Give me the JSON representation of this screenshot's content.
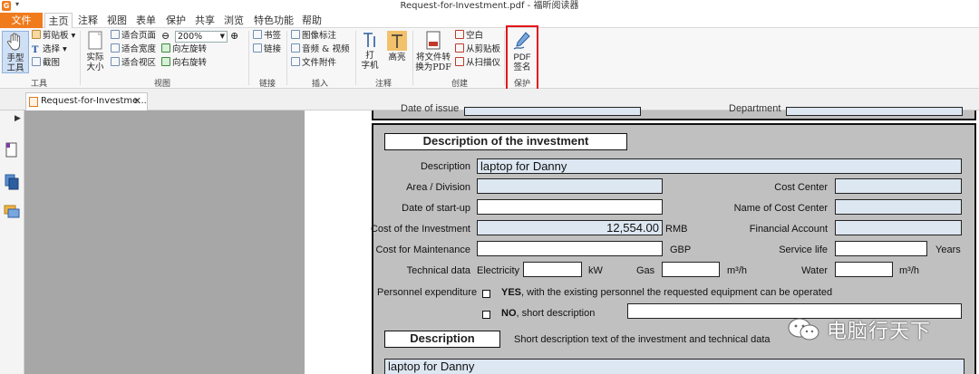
{
  "window": {
    "title": "Request-for-Investment.pdf - 福昕阅读器"
  },
  "menu": {
    "tabs": [
      "文件",
      "主页",
      "注释",
      "视图",
      "表单",
      "保护",
      "共享",
      "浏览",
      "特色功能",
      "帮助"
    ]
  },
  "ribbon": {
    "tools": {
      "hand_label_1": "手型",
      "hand_label_2": "工具",
      "clipboard": "剪贴板",
      "select": "选择",
      "screenshot": "截图",
      "group_label": "工具"
    },
    "view": {
      "actual_size_1": "实际",
      "actual_size_2": "大小",
      "fit_page": "适合页面",
      "fit_width": "适合宽度",
      "fit_visible": "适合视区",
      "zoom_value": "200%",
      "rotate_left": "向左旋转",
      "rotate_right": "向右旋转",
      "group_label": "视图"
    },
    "links": {
      "bookmark": "书签",
      "link": "链接",
      "group_label": "链接"
    },
    "insert": {
      "image_annot": "图像标注",
      "audio_video": "音频 & 视频",
      "file_attachment": "文件附件",
      "group_label": "插入"
    },
    "annot": {
      "typewriter_1": "打",
      "typewriter_2": "字机",
      "highlight": "高亮",
      "group_label": "注释"
    },
    "create": {
      "convert_1": "将文件转",
      "convert_2": "换为PDF",
      "blank": "空白",
      "from_clipboard": "从剪贴板",
      "from_scanner": "从扫描仪",
      "group_label": "创建"
    },
    "protect": {
      "pdf_sign_1": "PDF",
      "pdf_sign_2": "签名",
      "group_label": "保护"
    }
  },
  "doc_tab": {
    "label": "Request-for-Investme...",
    "close": "✕"
  },
  "form": {
    "top_cut_labels": {
      "date_of_issue": "Date of issue",
      "department": "Department"
    },
    "section1_title": "Description of the investment",
    "description_label": "Description",
    "description_value": "laptop for Danny",
    "area_label": "Area / Division",
    "cost_center_label": "Cost Center",
    "start_label": "Date of start-up",
    "cost_center_name_label": "Name of Cost Center",
    "cost_inv_label": "Cost of the Investment",
    "cost_inv_value": "12,554.00",
    "cost_inv_unit": "RMB",
    "fin_account_label": "Financial Account",
    "cost_maint_label": "Cost for Maintenance",
    "cost_maint_unit": "GBP",
    "service_life_label": "Service life",
    "service_life_unit": "Years",
    "tech_data_label": "Technical data",
    "electricity_label": "Electricity",
    "electricity_unit": "kW",
    "gas_label": "Gas",
    "gas_unit": "m³/h",
    "water_label": "Water",
    "water_unit": "m³/h",
    "personnel_label": "Personnel expenditure",
    "yes_bold": "YES",
    "yes_text": ", with the existing personnel the requested equipment can be operated",
    "no_bold": "NO",
    "no_text": ", short description",
    "section2_title": "Description",
    "section2_hint": "Short description text of the investment and technical data",
    "section2_value": "laptop for Danny"
  },
  "watermark": {
    "text": "电脑行天下"
  }
}
